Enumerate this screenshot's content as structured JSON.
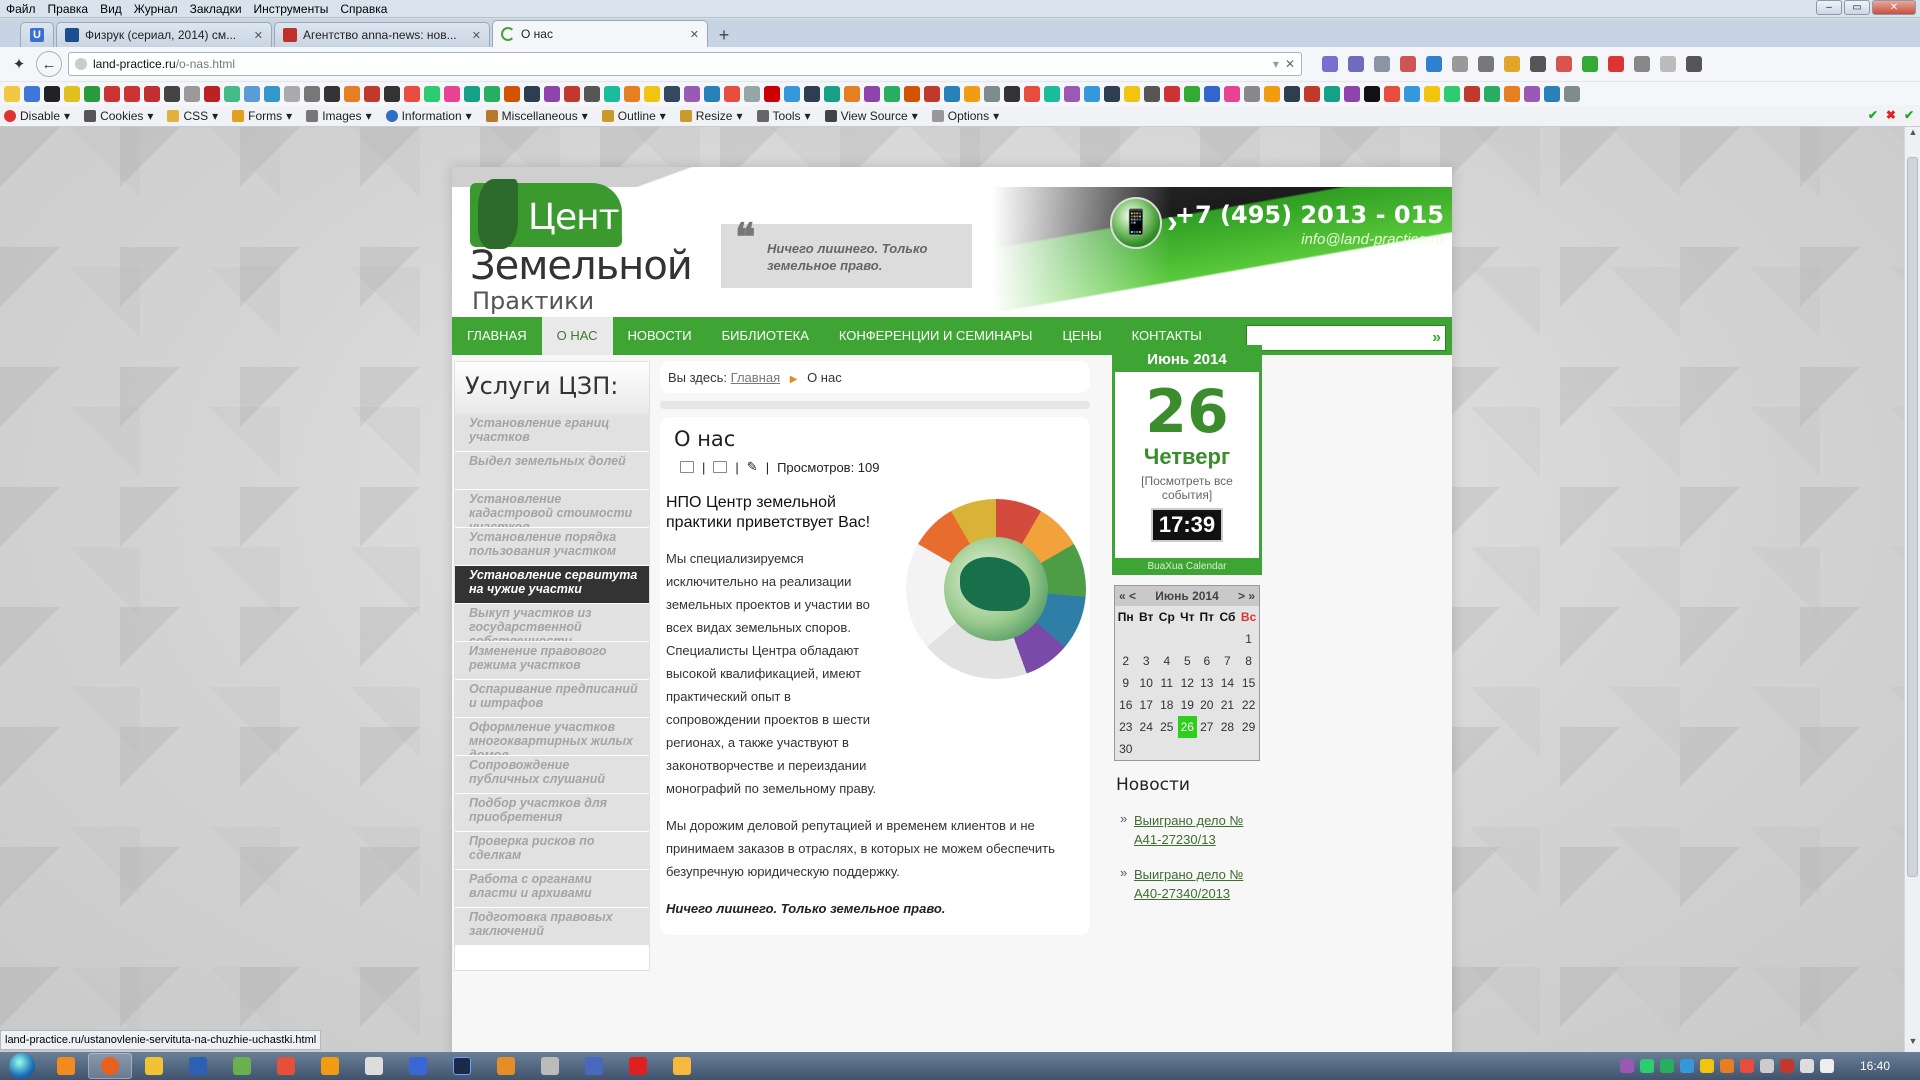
{
  "menu": [
    "Файл",
    "Правка",
    "Вид",
    "Журнал",
    "Закладки",
    "Инструменты",
    "Справка"
  ],
  "tabs": [
    {
      "label": "Физрук (сериал, 2014) см...",
      "icon": "film-icon",
      "color": "#1b4e8f"
    },
    {
      "label": "Агентство anna-news: нов...",
      "icon": "news-icon",
      "color": "#c0302a"
    },
    {
      "label": "О нас",
      "icon": "loading-icon",
      "color": "#3ea534"
    }
  ],
  "pinned_tab": "U",
  "url": {
    "host": "land-practice.ru",
    "path": "/o-nas.html"
  },
  "devbar": [
    "Disable",
    "Cookies",
    "CSS",
    "Forms",
    "Images",
    "Information",
    "Miscellaneous",
    "Outline",
    "Resize",
    "Tools",
    "View Source",
    "Options"
  ],
  "site": {
    "logo": {
      "line1": "Центр",
      "line2": "Земельной",
      "line3": "Практики"
    },
    "motto": "Ничего лишнего. Только земельное право.",
    "phone": "+7 (495) 2013 - 015",
    "email": "info@land-practice.ru",
    "nav": [
      "ГЛАВНАЯ",
      "О НАС",
      "НОВОСТИ",
      "БИБЛИОТЕКА",
      "КОНФЕРЕНЦИИ И СЕМИНАРЫ",
      "ЦЕНЫ",
      "КОНТАКТЫ"
    ],
    "nav_active": 1,
    "services_title": "Услуги ЦЗП:",
    "services": [
      "Установление границ участков",
      "Выдел земельных долей",
      "Установление кадастровой стоимости участков",
      "Установление порядка пользования участком",
      "Установление сервитута на чужие участки",
      "Выкуп участков из государственной собственности",
      "Изменение правового режима участков",
      "Оспаривание предписаний и штрафов",
      "Оформление участков многоквартирных жилых домов",
      "Сопровождение публичных слушаний",
      "Подбор участков для приобретения",
      "Проверка рисков по сделкам",
      "Работа с органами власти и архивами",
      "Подготовка правовых заключений"
    ],
    "services_active": 4,
    "breadcrumb": {
      "prefix": "Вы здесь:",
      "home": "Главная",
      "current": "О нас"
    },
    "article": {
      "title": "О нас",
      "views": "Просмотров: 109",
      "heading": "НПО Центр земельной практики приветствует Вас!",
      "p1": "Мы специализируемся исключительно на реализации земельных проектов и участии во всех видах земельных споров. Специалисты Центра обладают высокой квалификацией, имеют практический опыт в сопровождении проектов в шести регионах, а также участвуют в законотворчестве и переиздании монографий по земельному праву.",
      "p2": "Мы дорожим деловой репутацией и временем клиентов и не принимаем заказов в отраслях, в которых не можем обеспечить безупречную юридическую поддержку.",
      "p3": "Ничего лишнего. Только земельное право."
    },
    "calendar": {
      "month": "Июнь 2014",
      "day": "26",
      "weekday": "Четверг",
      "events_link": "[Посмотреть все события]",
      "time": "17:39",
      "footer": "BuaXua Calendar",
      "weekdays": [
        "Пн",
        "Вт",
        "Ср",
        "Чт",
        "Пт",
        "Сб",
        "Вс"
      ],
      "weeks": [
        [
          "",
          "",
          "",
          "",
          "",
          "",
          "1"
        ],
        [
          "2",
          "3",
          "4",
          "5",
          "6",
          "7",
          "8"
        ],
        [
          "9",
          "10",
          "11",
          "12",
          "13",
          "14",
          "15"
        ],
        [
          "16",
          "17",
          "18",
          "19",
          "20",
          "21",
          "22"
        ],
        [
          "23",
          "24",
          "25",
          "26",
          "27",
          "28",
          "29"
        ],
        [
          "30",
          "",
          "",
          "",
          "",
          "",
          ""
        ]
      ],
      "nav_prev": "« <",
      "nav_next": "> »"
    },
    "news_title": "Новости",
    "news": [
      "Выиграно дело № А41-27230/13",
      "Выиграно дело № А40-27340/2013"
    ]
  },
  "status_url": "land-practice.ru/ustanovlenie-servituta-na-chuzhie-uchastki.html",
  "clock": "16:40",
  "colors": {
    "brand_green": "#3ea534",
    "dark": "#333333",
    "accent_orange": "#e58a1f"
  }
}
